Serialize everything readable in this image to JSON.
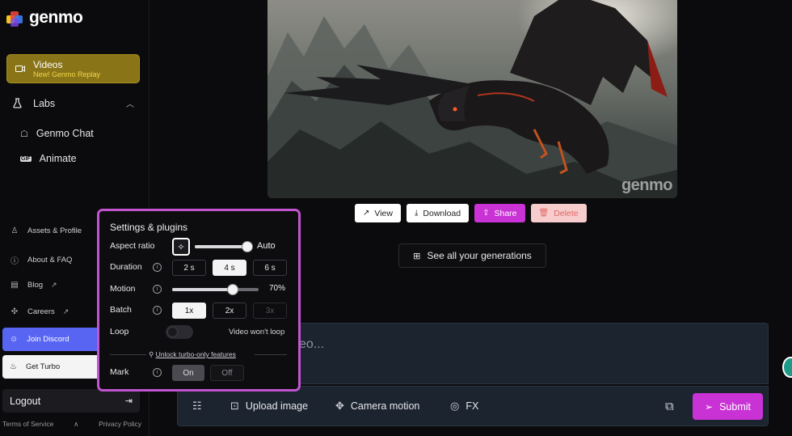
{
  "brand": {
    "name": "genmo",
    "colors": {
      "accent": "#c932d4",
      "videos_bg": "#8a7418",
      "discord": "#5865f2"
    }
  },
  "sidebar": {
    "videos": {
      "label": "Videos",
      "sublabel": "New! Genmo Replay",
      "icon": "video-camera-icon"
    },
    "labs": {
      "label": "Labs",
      "icon": "flask-icon",
      "expanded": true
    },
    "labs_items": [
      {
        "label": "Genmo Chat",
        "icon": "chat-icon"
      },
      {
        "label": "Animate",
        "icon": "gif-icon"
      }
    ],
    "links": [
      {
        "label": "Assets & Profile",
        "icon": "user-icon"
      },
      {
        "label": "About & FAQ",
        "icon": "help-icon"
      },
      {
        "label": "Blog",
        "icon": "blog-icon"
      },
      {
        "label": "Careers",
        "icon": "careers-icon"
      }
    ],
    "discord": {
      "label": "Join Discord",
      "icon": "discord-icon"
    },
    "turbo": {
      "label": "Get Turbo",
      "icon": "flame-icon"
    },
    "logout": {
      "label": "Logout",
      "icon": "logout-icon"
    },
    "footer": {
      "terms": "Terms of Service",
      "sep": "∧",
      "privacy": "Privacy Policy"
    }
  },
  "preview": {
    "watermark": "genmo",
    "actions": {
      "view": "View",
      "download": "Download",
      "share": "Share",
      "delete": "Delete"
    },
    "see_all": "See all your generations"
  },
  "settings": {
    "title": "Settings & plugins",
    "aspect_ratio": {
      "label": "Aspect ratio",
      "value": "Auto",
      "level": 1.0
    },
    "duration": {
      "label": "Duration",
      "options": [
        "2 s",
        "4 s",
        "6 s"
      ],
      "selected": "4 s"
    },
    "motion": {
      "label": "Motion",
      "value": "70%",
      "level": 0.7
    },
    "batch": {
      "label": "Batch",
      "options": [
        "1x",
        "2x",
        "3x"
      ],
      "selected": "1x",
      "disabled": [
        "3x"
      ]
    },
    "loop": {
      "label": "Loop",
      "enabled": false,
      "note": "Video won't loop"
    },
    "unlock": "Unlock turbo-only features",
    "mark": {
      "label": "Mark",
      "options": [
        "On",
        "Off"
      ],
      "selected": "On"
    }
  },
  "prompt": {
    "placeholder": "eo...",
    "toolbar": {
      "upload": "Upload image",
      "camera": "Camera motion",
      "fx": "FX",
      "submit": "Submit"
    }
  }
}
